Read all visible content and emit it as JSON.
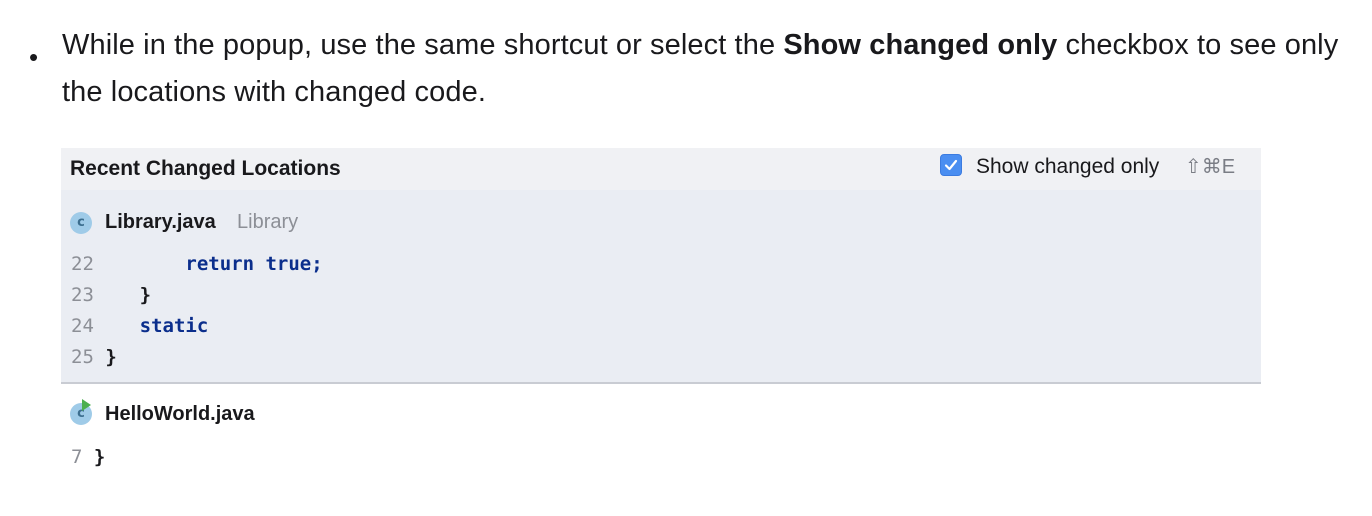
{
  "bullet": {
    "text_before": "While in the popup, use the same shortcut or select the ",
    "bold": "Show changed only",
    "text_after": " checkbox to see only the locations with changed code."
  },
  "popup": {
    "title": "Recent Changed Locations",
    "checkbox_label": "Show changed only",
    "checkbox_checked": true,
    "shortcut": "⇧⌘E",
    "colors": {
      "accent": "#4a8ef1",
      "keyword": "#0b2e8c",
      "section_bg": "#eaedf3",
      "header_bg": "#f0f1f4"
    },
    "files": [
      {
        "name": "Library.java",
        "module": "Library",
        "icon": "java-class-icon",
        "lines": [
          {
            "num": "22",
            "code": "return true;"
          },
          {
            "num": "23",
            "code": "}"
          },
          {
            "num": "24",
            "code": "static"
          },
          {
            "num": "25",
            "code": "}"
          }
        ]
      },
      {
        "name": "HelloWorld.java",
        "module": "",
        "icon": "java-runnable-class-icon",
        "lines": [
          {
            "num": "7",
            "code": "}"
          }
        ]
      }
    ]
  }
}
